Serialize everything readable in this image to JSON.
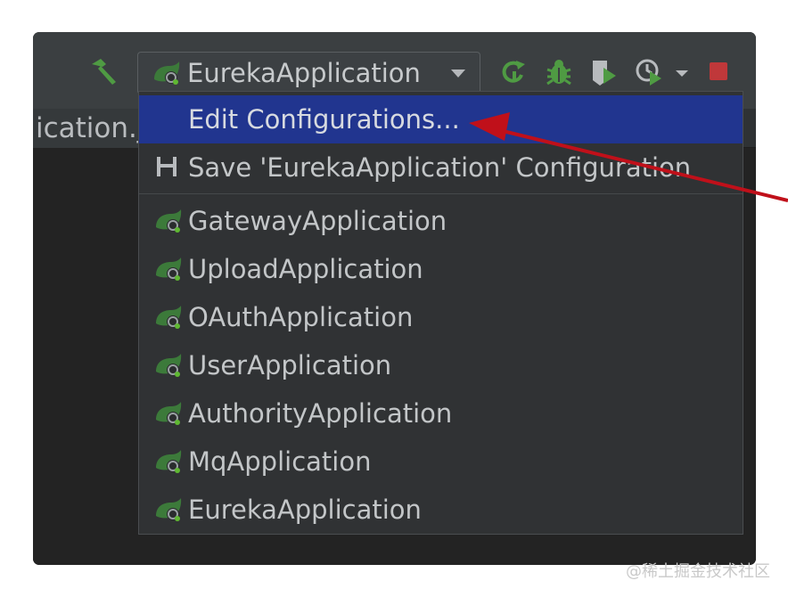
{
  "toolbar": {
    "run_config": "EurekaApplication"
  },
  "editor_tab": {
    "label": "ication.j"
  },
  "menu": {
    "edit_configurations": "Edit Configurations...",
    "save_configuration": "Save 'EurekaApplication' Configuration",
    "configurations": [
      {
        "label": "GatewayApplication",
        "icon": "spring-boot-icon"
      },
      {
        "label": "UploadApplication",
        "icon": "spring-boot-icon"
      },
      {
        "label": "OAuthApplication",
        "icon": "spring-boot-icon"
      },
      {
        "label": "UserApplication",
        "icon": "spring-boot-icon"
      },
      {
        "label": "AuthorityApplication",
        "icon": "spring-boot-icon"
      },
      {
        "label": "MqApplication",
        "icon": "spring-boot-icon"
      },
      {
        "label": "EurekaApplication",
        "icon": "spring-boot-icon"
      }
    ]
  },
  "watermark": "@稀土掘金技术社区",
  "colors": {
    "selection": "#21358f",
    "annotation_arrow": "#c0101a",
    "spring_green": "#5fb832"
  }
}
